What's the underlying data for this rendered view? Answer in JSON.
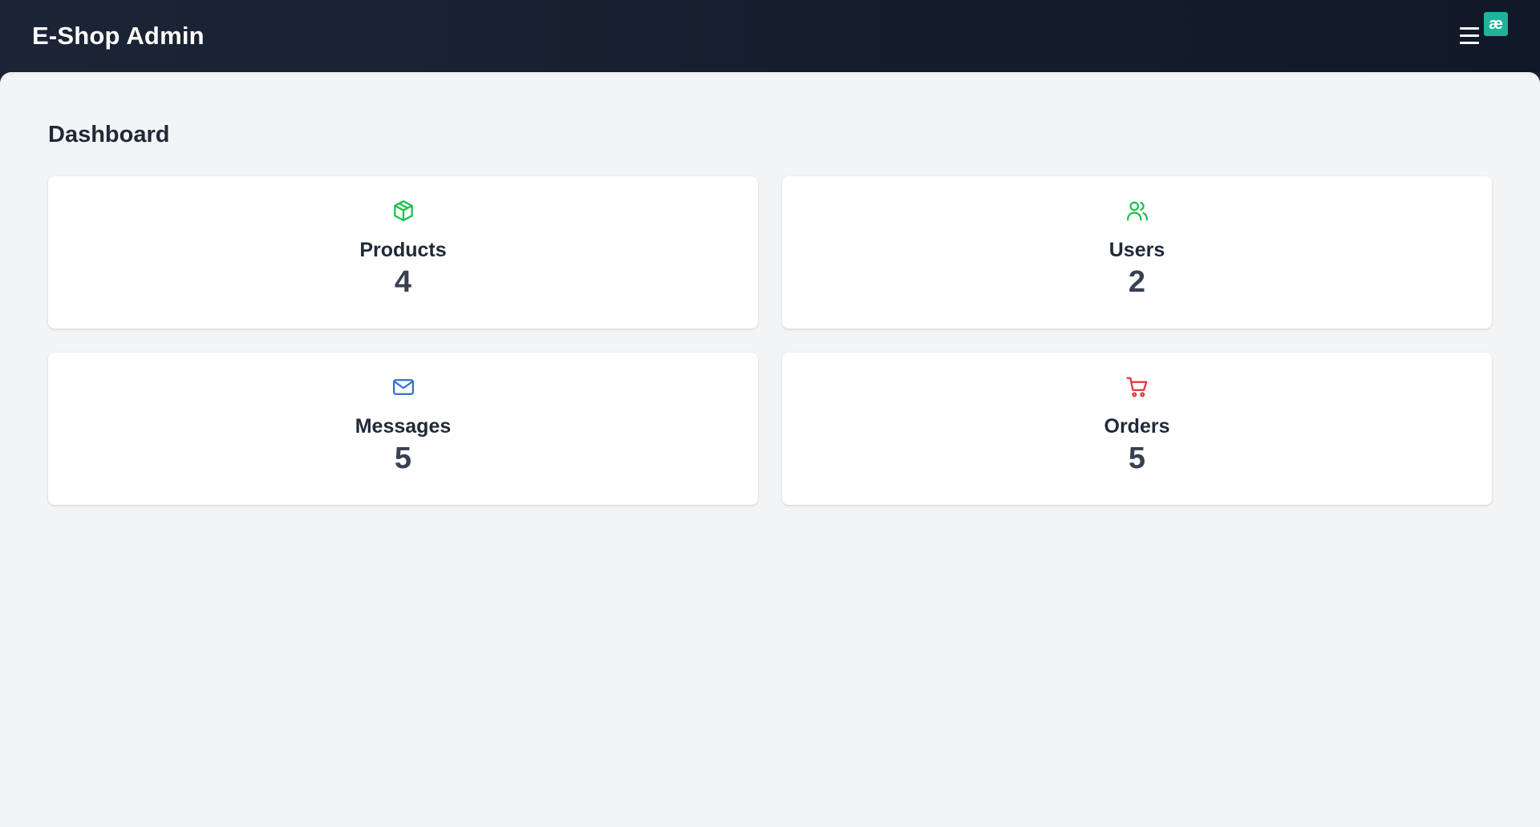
{
  "app": {
    "title": "E-Shop Admin",
    "extension_badge": "æ"
  },
  "header": {
    "menu_icon": "hamburger-menu-icon"
  },
  "main": {
    "title": "Dashboard"
  },
  "cards": [
    {
      "label": "Products",
      "value": "4",
      "icon": "package-icon",
      "icon_color": "#16c24a"
    },
    {
      "label": "Users",
      "value": "2",
      "icon": "users-icon",
      "icon_color": "#16c24a"
    },
    {
      "label": "Messages",
      "value": "5",
      "icon": "mail-icon",
      "icon_color": "#2f6fd6"
    },
    {
      "label": "Orders",
      "value": "5",
      "icon": "shopping-cart-icon",
      "icon_color": "#e5343b"
    }
  ]
}
